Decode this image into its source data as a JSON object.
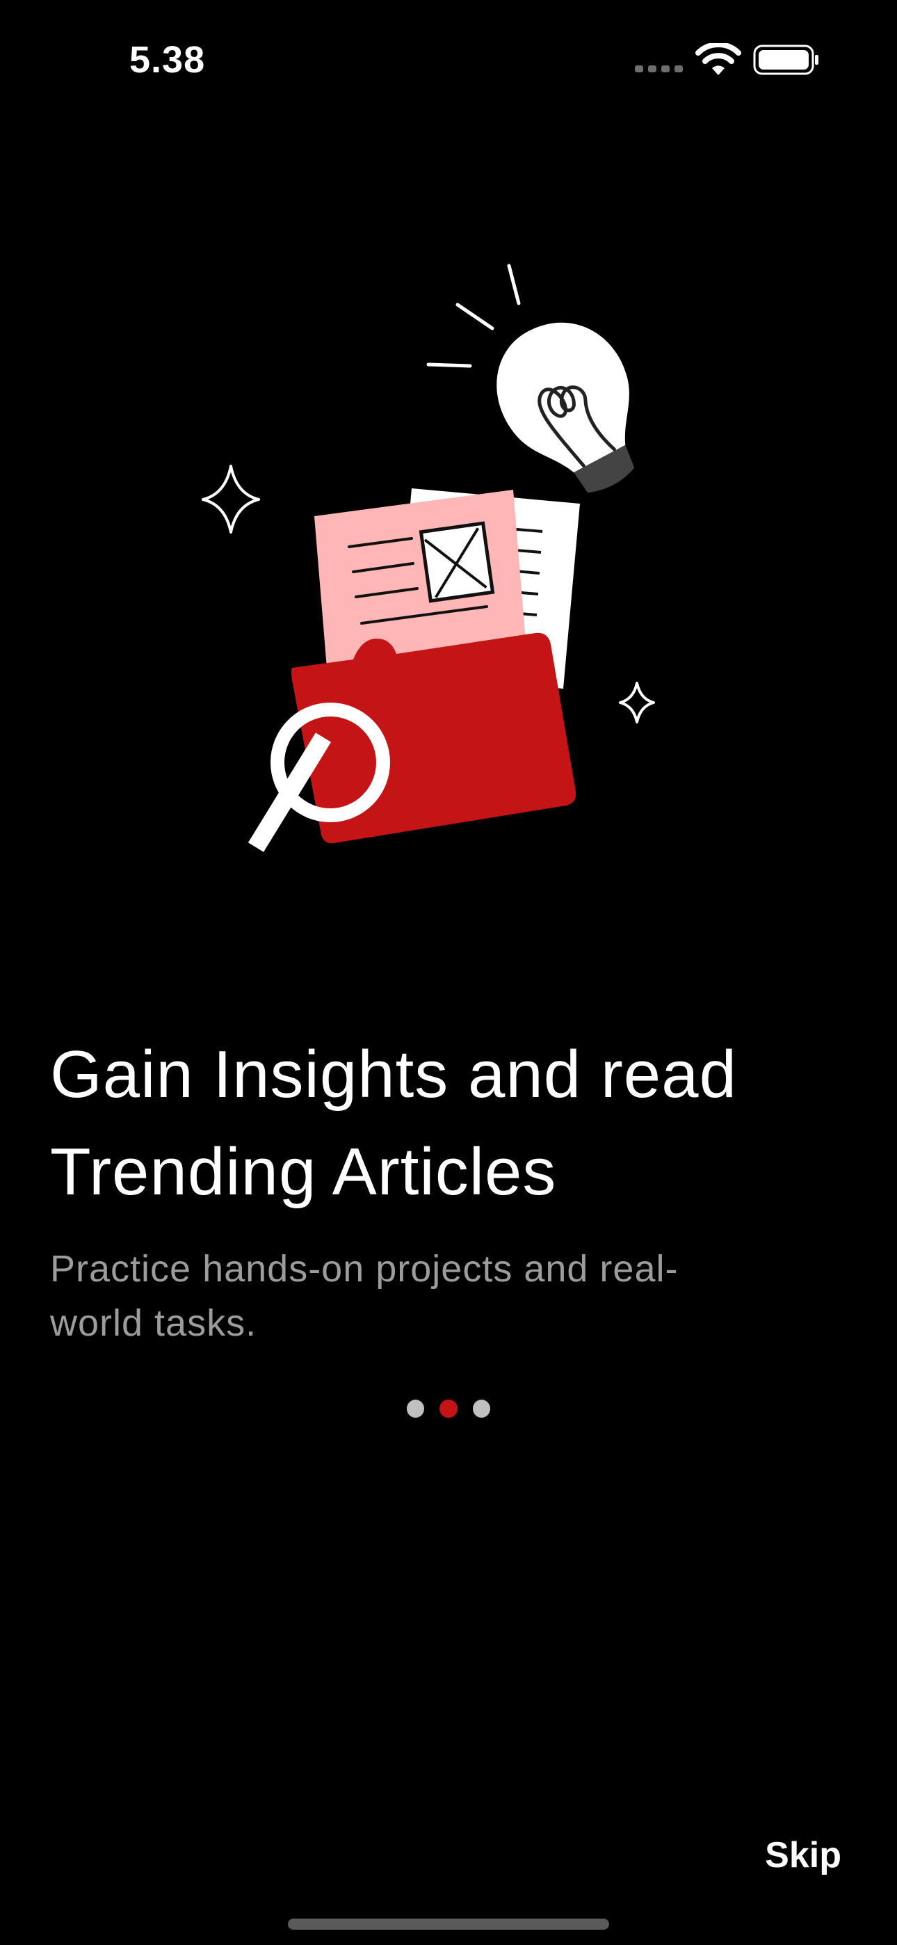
{
  "status_bar": {
    "time": "5.38",
    "icons": [
      "cellular-signal-icon",
      "wifi-icon",
      "battery-icon"
    ]
  },
  "illustration": {
    "name": "folder-document-magnifier-lightbulb-illustration",
    "colors": {
      "folder": "#c41416",
      "document": "#ffb6b6",
      "outline": "#ffffff"
    }
  },
  "onboarding": {
    "headline_line1": "Gain Insights and read",
    "headline_line2": "Trending Articles",
    "subtitle_line1": "Practice hands-on projects and real-",
    "subtitle_line2": "world tasks.",
    "page_count": 3,
    "current_page": 2
  },
  "actions": {
    "skip_label": "Skip"
  },
  "theme": {
    "background": "#000000",
    "accent": "#c41416",
    "text_primary": "#ffffff",
    "text_secondary": "#9c9c9c",
    "dot_inactive": "#c0c0c0"
  }
}
